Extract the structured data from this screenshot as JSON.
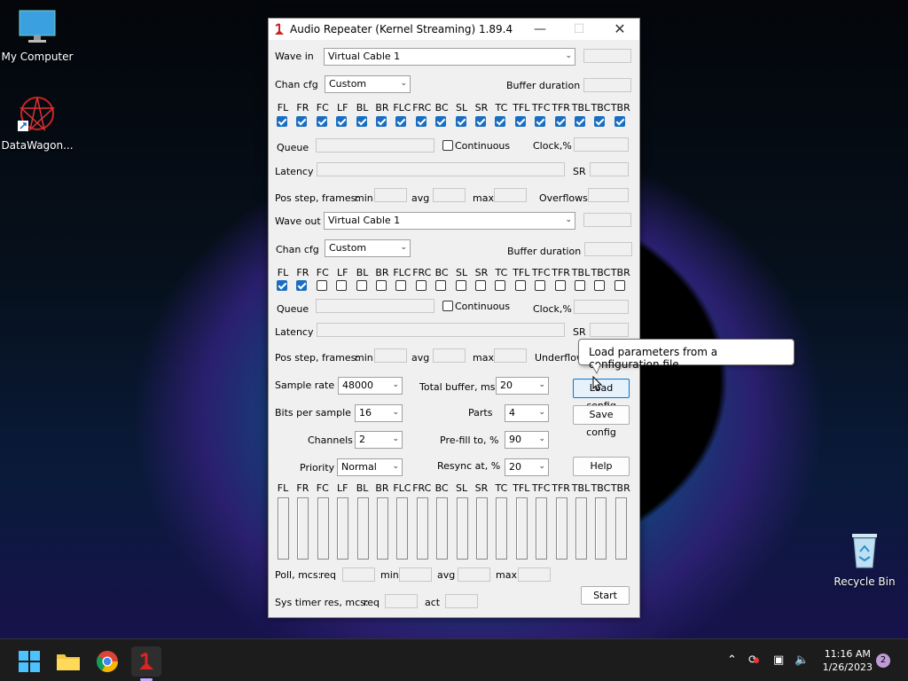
{
  "desktop": {
    "icons": [
      {
        "label": "My Computer",
        "icon": "monitor-icon"
      },
      {
        "label": "DataWagon...",
        "icon": "datawagon-icon"
      },
      {
        "label": "Recycle Bin",
        "icon": "recycle-bin-icon"
      }
    ]
  },
  "window": {
    "title": "Audio Repeater (Kernel Streaming) 1.89.4"
  },
  "wave_in": {
    "label": "Wave in",
    "device": "Virtual Cable 1",
    "chan_cfg_label": "Chan cfg",
    "chan_cfg": "Custom",
    "buffer_duration_label": "Buffer duration",
    "channels": [
      "FL",
      "FR",
      "FC",
      "LF",
      "BL",
      "BR",
      "FLC",
      "FRC",
      "BC",
      "SL",
      "SR",
      "TC",
      "TFL",
      "TFC",
      "TFR",
      "TBL",
      "TBC",
      "TBR"
    ],
    "checked": [
      true,
      true,
      true,
      true,
      true,
      true,
      true,
      true,
      true,
      true,
      true,
      true,
      true,
      true,
      true,
      true,
      true,
      true
    ],
    "queue_label": "Queue",
    "continuous_label": "Continuous",
    "clock_label": "Clock,%",
    "latency_label": "Latency",
    "sr_label": "SR",
    "pos_step_label": "Pos step, frames:",
    "min_label": "min",
    "avg_label": "avg",
    "max_label": "max",
    "overflows_label": "Overflows"
  },
  "wave_out": {
    "label": "Wave out",
    "device": "Virtual Cable 1",
    "chan_cfg_label": "Chan cfg",
    "chan_cfg": "Custom",
    "buffer_duration_label": "Buffer duration",
    "channels": [
      "FL",
      "FR",
      "FC",
      "LF",
      "BL",
      "BR",
      "FLC",
      "FRC",
      "BC",
      "SL",
      "SR",
      "TC",
      "TFL",
      "TFC",
      "TFR",
      "TBL",
      "TBC",
      "TBR"
    ],
    "checked": [
      true,
      true,
      false,
      false,
      false,
      false,
      false,
      false,
      false,
      false,
      false,
      false,
      false,
      false,
      false,
      false,
      false,
      false
    ],
    "queue_label": "Queue",
    "continuous_label": "Continuous",
    "clock_label": "Clock,%",
    "latency_label": "Latency",
    "sr_label": "SR",
    "pos_step_label": "Pos step, frames:",
    "min_label": "min",
    "avg_label": "avg",
    "max_label": "max",
    "underflows_label": "Underflows"
  },
  "settings": {
    "sample_rate_label": "Sample rate",
    "sample_rate": "48000",
    "total_buffer_label": "Total buffer, ms",
    "total_buffer": "20",
    "bits_label": "Bits per sample",
    "bits": "16",
    "parts_label": "Parts",
    "parts": "4",
    "channels_label": "Channels",
    "channels": "2",
    "prefill_label": "Pre-fill to, %",
    "prefill": "90",
    "priority_label": "Priority",
    "priority": "Normal",
    "resync_label": "Resync at, %",
    "resync": "20"
  },
  "buttons": {
    "load_config": "Load config",
    "save_config": "Save config",
    "help": "Help",
    "start": "Start"
  },
  "tooltip": "Load parameters from a configuration file",
  "meters": {
    "channels": [
      "FL",
      "FR",
      "FC",
      "LF",
      "BL",
      "BR",
      "FLC",
      "FRC",
      "BC",
      "SL",
      "SR",
      "TC",
      "TFL",
      "TFC",
      "TFR",
      "TBL",
      "TBC",
      "TBR"
    ]
  },
  "poll": {
    "label": "Poll, mcs:",
    "req_label": "req",
    "min_label": "min",
    "avg_label": "avg",
    "max_label": "max"
  },
  "systimer": {
    "label": "Sys timer res, mcs:",
    "req_label": "req",
    "act_label": "act"
  },
  "taskbar": {
    "time": "11:16 AM",
    "date": "1/26/2023",
    "notifications": "2"
  },
  "colors": {
    "accent": "#1a6ec2",
    "checkbox_checked": "#1a6ec2"
  }
}
